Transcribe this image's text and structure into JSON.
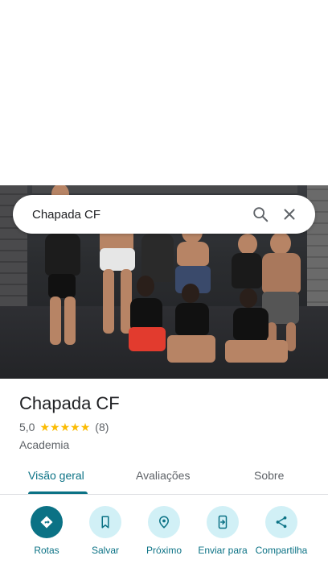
{
  "search": {
    "query": "Chapada CF"
  },
  "place": {
    "name": "Chapada CF",
    "rating": "5,0",
    "review_count": "(8)",
    "stars": 5,
    "category": "Academia"
  },
  "tabs": [
    {
      "label": "Visão geral",
      "active": true
    },
    {
      "label": "Avaliações",
      "active": false
    },
    {
      "label": "Sobre",
      "active": false
    }
  ],
  "actions": [
    {
      "label": "Rotas",
      "icon": "directions-icon"
    },
    {
      "label": "Salvar",
      "icon": "bookmark-icon"
    },
    {
      "label": "Próximo",
      "icon": "nearby-icon"
    },
    {
      "label": "Enviar para",
      "icon": "send-to-phone-icon"
    },
    {
      "label": "Compartilha",
      "icon": "share-icon"
    }
  ],
  "colors": {
    "accent": "#0b7285",
    "action_bg": "#d1f0f6",
    "star": "#fbbc04"
  }
}
